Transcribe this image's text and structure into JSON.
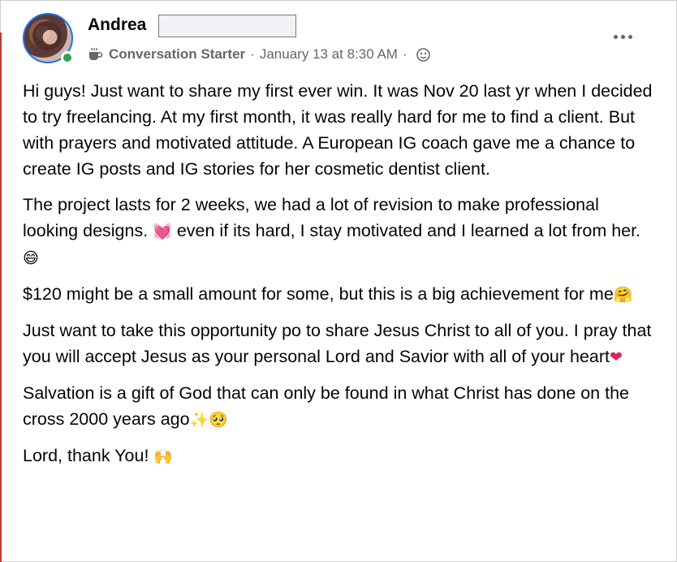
{
  "post": {
    "author": "Andrea",
    "badge": "Conversation Starter",
    "separator": "·",
    "timestamp": "January 13 at 8:30 AM",
    "more_label": "•••",
    "paragraphs": [
      "Hi guys! Just want to share my first ever win. It was Nov 20 last yr when I decided to try freelancing. At my first month, it was really hard for me to find a client. But with prayers and motivated attitude.  A European IG coach gave me a chance to create IG posts and IG stories for her cosmetic dentist client.",
      " The project lasts for 2 weeks, we had a lot of revision to make professional looking designs. ",
      " even if its hard, I stay motivated and I learned a lot from her.",
      "$120 might be a small amount for some, but this is a big achievement for me",
      "Just want to take this opportunity po to share Jesus Christ to all of you. I pray that you will accept Jesus as your personal Lord and Savior with all of your heart",
      "Salvation is a gift of God that can only be found in what Christ has done on the cross 2000 years ago",
      "Lord, thank You! "
    ],
    "emojis": {
      "heart_with_lines": "💓",
      "grin": "😄",
      "hug": "🤗",
      "red_heart": "❤",
      "sparkles": "✨",
      "pleading": "🥺",
      "raised_hands": "🙌"
    }
  },
  "colors": {
    "accent": "#1b74e4",
    "online": "#31a24c",
    "meta_text": "#65676b",
    "left_accent_line": "#c03a32"
  },
  "icons": [
    "avatar",
    "online-status-icon",
    "coffee-cup-icon",
    "globe-icon",
    "more-options-icon"
  ]
}
